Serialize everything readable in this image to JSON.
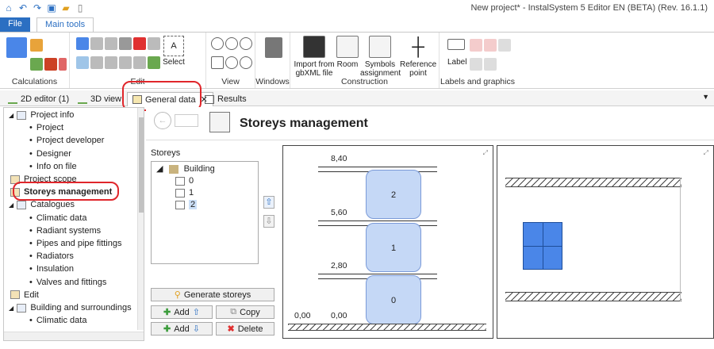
{
  "window": {
    "title": "New project* - InstalSystem 5 Editor EN (BETA) (Rev. 16.1.1)"
  },
  "ribbon_tabs": [
    "File",
    "Main tools"
  ],
  "ribbon": {
    "groups": [
      "Calculations",
      "Edit",
      "View",
      "Windows",
      "Construction",
      "Labels and graphics"
    ],
    "select_label": "Select",
    "construction_buttons": [
      "Import from gbXML file",
      "Room",
      "Symbols assignment",
      "Reference point"
    ],
    "label_button": "Label"
  },
  "doc_tabs": [
    "2D editor (1)",
    "3D view",
    "General data",
    "Results"
  ],
  "tree": [
    {
      "label": "Project info",
      "level": 0,
      "type": "folder"
    },
    {
      "label": "Project",
      "level": 1,
      "type": "bullet"
    },
    {
      "label": "Project developer",
      "level": 1,
      "type": "bullet"
    },
    {
      "label": "Designer",
      "level": 1,
      "type": "bullet"
    },
    {
      "label": "Info on file",
      "level": 1,
      "type": "bullet"
    },
    {
      "label": "Project scope",
      "level": 0,
      "type": "item"
    },
    {
      "label": "Storeys management",
      "level": 0,
      "type": "item",
      "selected": true
    },
    {
      "label": "Catalogues",
      "level": 0,
      "type": "folder"
    },
    {
      "label": "Climatic data",
      "level": 1,
      "type": "bullet"
    },
    {
      "label": "Radiant systems",
      "level": 1,
      "type": "bullet"
    },
    {
      "label": "Pipes and pipe fittings",
      "level": 1,
      "type": "bullet"
    },
    {
      "label": "Radiators",
      "level": 1,
      "type": "bullet"
    },
    {
      "label": "Insulation",
      "level": 1,
      "type": "bullet"
    },
    {
      "label": "Valves and fittings",
      "level": 1,
      "type": "bullet"
    },
    {
      "label": "Edit",
      "level": 0,
      "type": "item"
    },
    {
      "label": "Building and surroundings",
      "level": 0,
      "type": "folder"
    },
    {
      "label": "Climatic data",
      "level": 1,
      "type": "bullet"
    }
  ],
  "page": {
    "title": "Storeys management"
  },
  "storeys": {
    "heading": "Storeys",
    "root": "Building",
    "items": [
      "0",
      "1",
      "2"
    ],
    "selected": "2"
  },
  "buttons": {
    "generate": "Generate storeys",
    "add1": "Add",
    "add2": "Add",
    "copy": "Copy",
    "delete": "Delete"
  },
  "section": {
    "levels": [
      "8,40",
      "5,60",
      "2,80",
      "0,00",
      "0,00"
    ],
    "storey_labels": [
      "2",
      "1",
      "0"
    ]
  },
  "colors": {
    "accent": "#2b6fc2",
    "highlight": "#e0262b",
    "storey_fill": "#c5d8f6",
    "plan_fill": "#4a86e8"
  }
}
